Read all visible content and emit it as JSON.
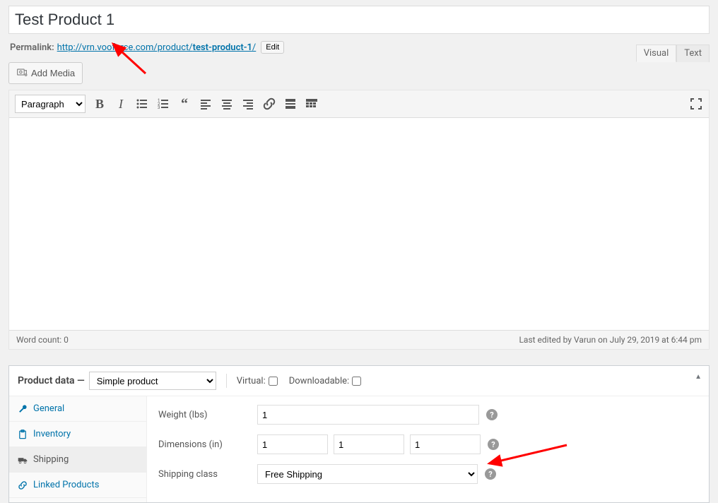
{
  "title": "Test Product 1",
  "permalink": {
    "label": "Permalink:",
    "base": "http://vrn.vooforce.com/product/",
    "slug": "test-product-1",
    "trail": "/",
    "edit_label": "Edit"
  },
  "add_media_label": "Add Media",
  "editor_tabs": {
    "visual": "Visual",
    "text": "Text"
  },
  "format_dropdown": "Paragraph",
  "word_count_label": "Word count: 0",
  "last_edited": "Last edited by Varun on July 29, 2019 at 6:44 pm",
  "product_data": {
    "header_label": "Product data —",
    "type": "Simple product",
    "virtual_label": "Virtual:",
    "downloadable_label": "Downloadable:",
    "tabs": {
      "general": "General",
      "inventory": "Inventory",
      "shipping": "Shipping",
      "linked": "Linked Products"
    },
    "weight_label": "Weight (lbs)",
    "weight_value": "1",
    "dimensions_label": "Dimensions (in)",
    "dim_l": "1",
    "dim_w": "1",
    "dim_h": "1",
    "class_label": "Shipping class",
    "class_value": "Free Shipping"
  }
}
